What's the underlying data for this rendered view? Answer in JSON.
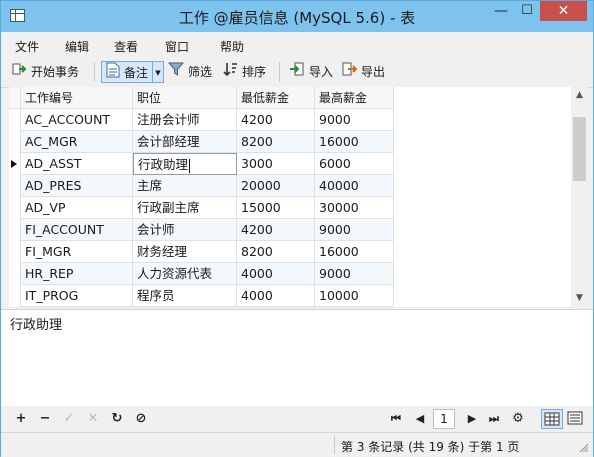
{
  "window": {
    "title": "工作 @雇员信息 (MySQL 5.6) - 表",
    "minimize_glyph": "—",
    "maximize_glyph": "☐",
    "close_glyph": "✕"
  },
  "menu": [
    "文件",
    "编辑",
    "查看",
    "窗口",
    "帮助"
  ],
  "toolbar": {
    "begin_transaction": "开始事务",
    "memo": "备注",
    "filter": "筛选",
    "sort": "排序",
    "import": "导入",
    "export": "导出"
  },
  "table": {
    "columns": [
      "工作编号",
      "职位",
      "最低薪金",
      "最高薪金"
    ],
    "rows": [
      [
        "AC_ACCOUNT",
        "注册会计师",
        "4200",
        "9000"
      ],
      [
        "AC_MGR",
        "会计部经理",
        "8200",
        "16000"
      ],
      [
        "AD_ASST",
        "行政助理",
        "3000",
        "6000"
      ],
      [
        "AD_PRES",
        "主席",
        "20000",
        "40000"
      ],
      [
        "AD_VP",
        "行政副主席",
        "15000",
        "30000"
      ],
      [
        "FI_ACCOUNT",
        "会计师",
        "4200",
        "9000"
      ],
      [
        "FI_MGR",
        "财务经理",
        "8200",
        "16000"
      ],
      [
        "HR_REP",
        "人力资源代表",
        "4000",
        "9000"
      ],
      [
        "IT_PROG",
        "程序员",
        "4000",
        "10000"
      ]
    ],
    "current_row": 2
  },
  "memo_text": "行政助理",
  "navbar": {
    "add": "+",
    "delete": "−",
    "apply": "✓",
    "cancel": "✕",
    "refresh": "↻",
    "stop": "⊘",
    "first": "⏮",
    "prev": "◀",
    "page": "1",
    "next": "▶",
    "last": "⏭",
    "settings": "⚙"
  },
  "status": {
    "record_text": "第 3 条记录 (共 19 条) 于第 1 页"
  },
  "colors": {
    "titlebar": "#7ec2ee",
    "close_button": "#c7504a",
    "selected_button": "#d5e7f8",
    "grid_alt_row": "#f3f8fd"
  }
}
